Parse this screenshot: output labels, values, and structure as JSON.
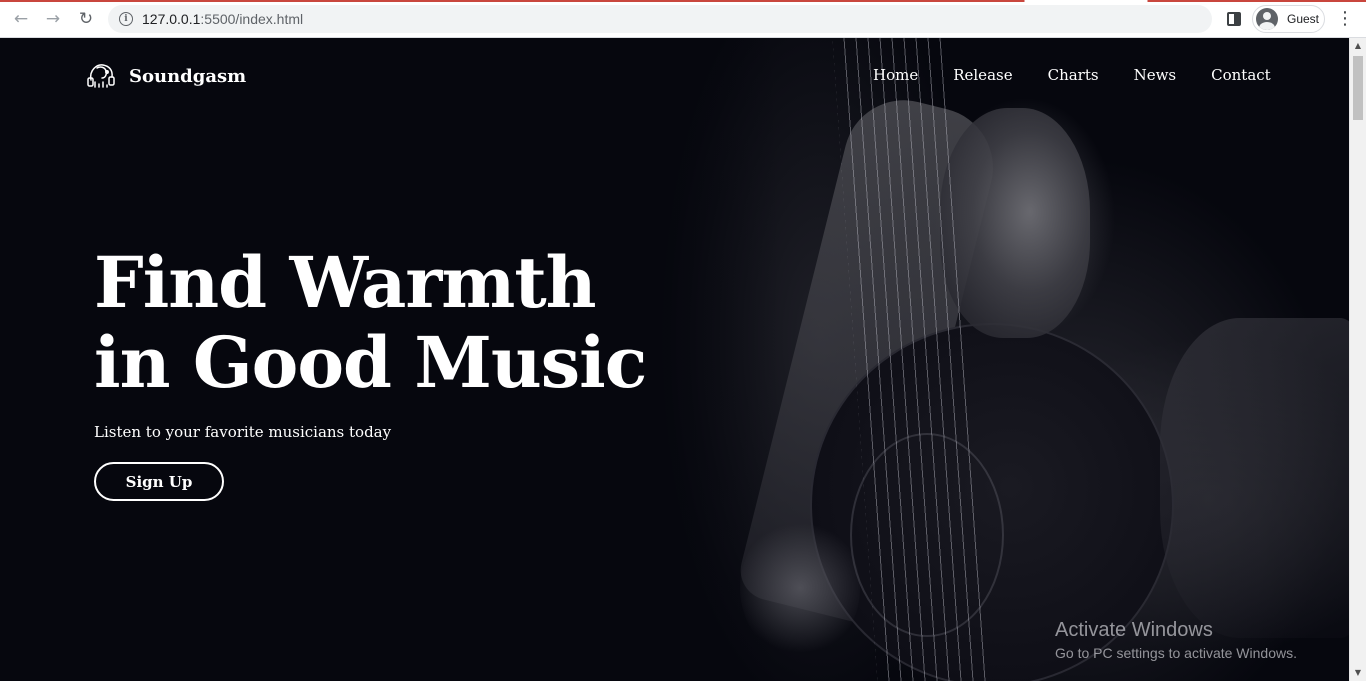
{
  "browser": {
    "url_host": "127.0.0.1",
    "url_path": ":5500/index.html",
    "profile_name": "Guest",
    "icons": {
      "back": "arrow-left-icon",
      "forward": "arrow-right-icon",
      "reload": "reload-icon",
      "info": "info-icon",
      "side_panel": "side-panel-icon",
      "menu": "kebab-menu-icon"
    }
  },
  "site": {
    "brand": "Soundgasm",
    "nav": [
      "Home",
      "Release",
      "Charts",
      "News",
      "Contact"
    ],
    "hero": {
      "title_line1": "Find Warmth",
      "title_line2": "in Good Music",
      "subtitle": "Listen to your favorite musicians today",
      "cta": "Sign Up"
    }
  },
  "os_overlay": {
    "title": "Activate Windows",
    "subtitle": "Go to PC settings to activate Windows."
  },
  "colors": {
    "page_background": "#06070e",
    "text": "#ffffff",
    "browser_accent": "#c9463d"
  }
}
